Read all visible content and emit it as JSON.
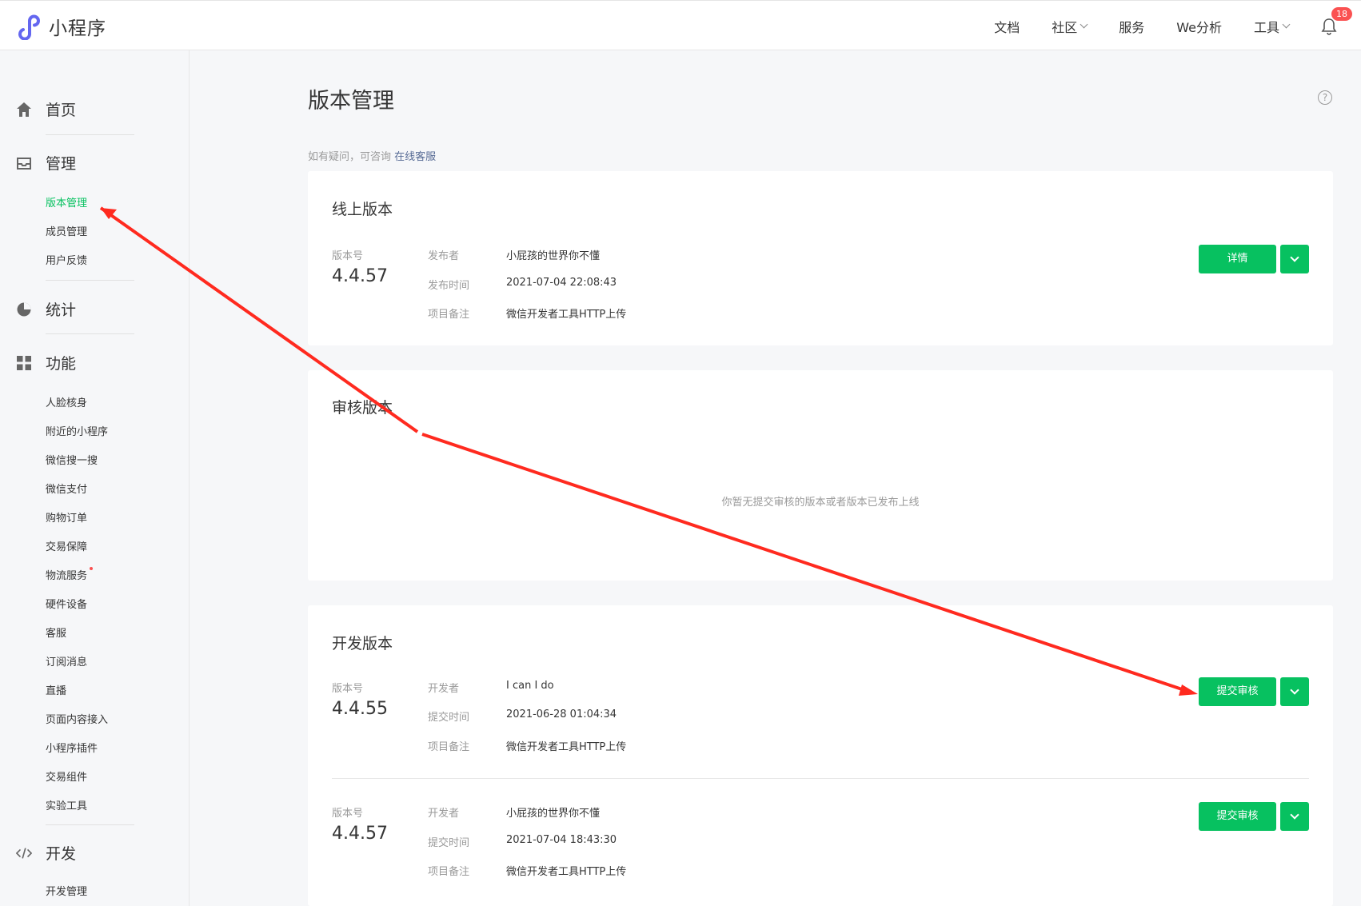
{
  "header": {
    "app_name": "小程序",
    "nav": [
      "文档",
      "社区",
      "服务",
      "We分析",
      "工具"
    ],
    "notification_count": "18"
  },
  "sidebar": {
    "home": "首页",
    "manage": "管理",
    "manage_items": [
      "版本管理",
      "成员管理",
      "用户反馈"
    ],
    "stats": "统计",
    "features": "功能",
    "feature_items": [
      "人脸核身",
      "附近的小程序",
      "微信搜一搜",
      "微信支付",
      "购物订单",
      "交易保障",
      "物流服务",
      "硬件设备",
      "客服",
      "订阅消息",
      "直播",
      "页面内容接入",
      "小程序插件",
      "交易组件",
      "实验工具"
    ],
    "dev": "开发",
    "dev_items": [
      "开发管理"
    ]
  },
  "main": {
    "title": "版本管理",
    "help_icon": "?",
    "inquiry_text": "如有疑问，可咨询",
    "inquiry_link": "在线客服",
    "online": {
      "title": "线上版本",
      "version_label": "版本号",
      "version": "4.4.57",
      "fields": [
        {
          "key": "发布者",
          "value": "小屁孩的世界你不懂"
        },
        {
          "key": "发布时间",
          "value": "2021-07-04 22:08:43"
        },
        {
          "key": "项目备注",
          "value": "微信开发者工具HTTP上传"
        }
      ],
      "button": "详情"
    },
    "review": {
      "title": "审核版本",
      "empty": "你暂无提交审核的版本或者版本已发布上线"
    },
    "dev": {
      "title": "开发版本",
      "items": [
        {
          "version_label": "版本号",
          "version": "4.4.55",
          "fields": [
            {
              "key": "开发者",
              "value": "I can I do"
            },
            {
              "key": "提交时间",
              "value": "2021-06-28 01:04:34"
            },
            {
              "key": "项目备注",
              "value": "微信开发者工具HTTP上传"
            }
          ],
          "button": "提交审核"
        },
        {
          "version_label": "版本号",
          "version": "4.4.57",
          "fields": [
            {
              "key": "开发者",
              "value": "小屁孩的世界你不懂"
            },
            {
              "key": "提交时间",
              "value": "2021-07-04 18:43:30"
            },
            {
              "key": "项目备注",
              "value": "微信开发者工具HTTP上传"
            }
          ],
          "button": "提交审核"
        }
      ]
    }
  },
  "colors": {
    "accent": "#07c160",
    "annotation": "#ff2a1f",
    "link": "#576b95"
  }
}
